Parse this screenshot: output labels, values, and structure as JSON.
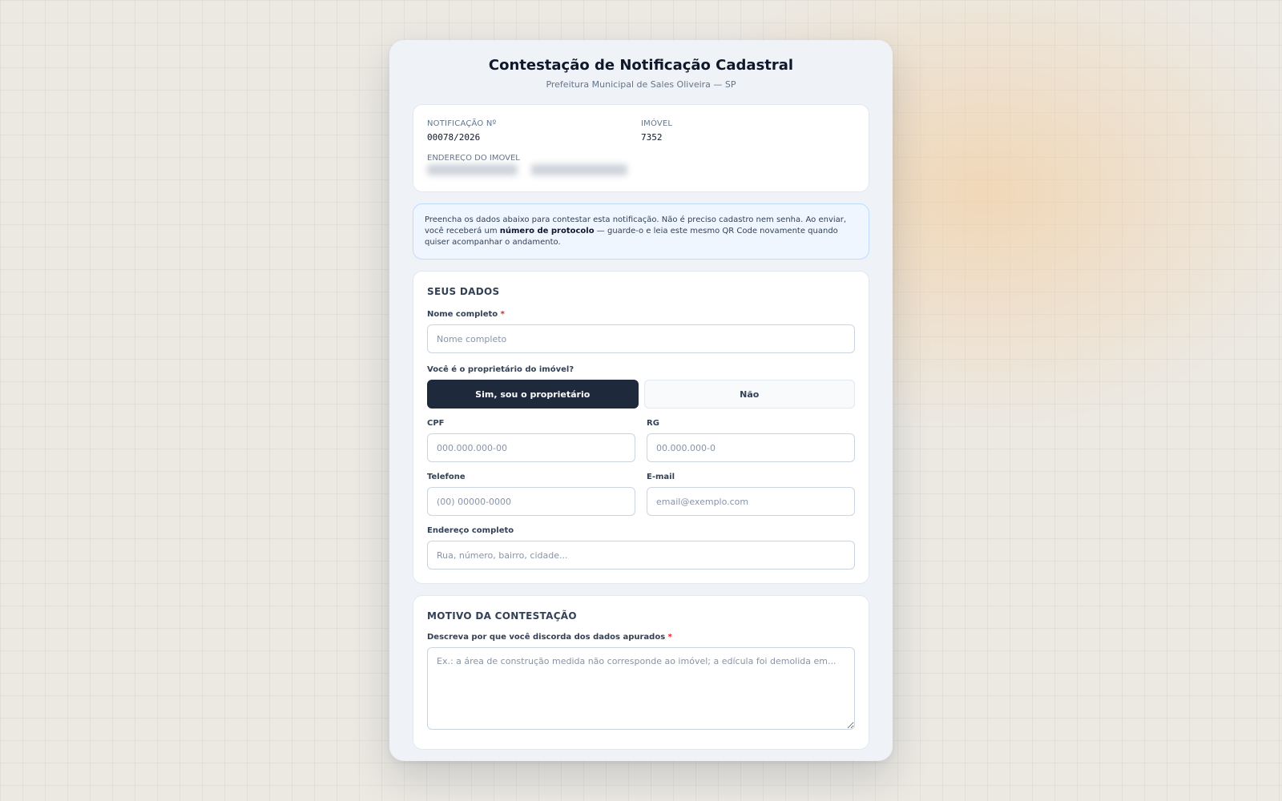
{
  "header": {
    "title": "Contestação de Notificação Cadastral",
    "subtitle": "Prefeitura Municipal de Sales Oliveira — SP"
  },
  "info": {
    "notification_label": "NOTIFICAÇÃO Nº",
    "notification_value": "00078/2026",
    "property_label": "IMÓVEL",
    "property_value": "7352",
    "address_label": "ENDEREÇO DO IMÓVEL"
  },
  "notice": {
    "text_before": "Preencha os dados abaixo para contestar esta notificação. Não é preciso cadastro nem senha. Ao enviar, você receberá um ",
    "text_bold": "número de protocolo",
    "text_after": " — guarde-o e leia este mesmo QR Code novamente quando quiser acompanhar o andamento."
  },
  "personal": {
    "section_title": "SEUS DADOS",
    "name_label": "Nome completo",
    "name_placeholder": "Nome completo",
    "owner_question": "Você é o proprietário do imóvel?",
    "owner_yes": "Sim, sou o proprietário",
    "owner_no": "Não",
    "cpf_label": "CPF",
    "cpf_placeholder": "000.000.000-00",
    "rg_label": "RG",
    "rg_placeholder": "00.000.000-0",
    "phone_label": "Telefone",
    "phone_placeholder": "(00) 00000-0000",
    "email_label": "E-mail",
    "email_placeholder": "email@exemplo.com",
    "address_label": "Endereço completo",
    "address_placeholder": "Rua, número, bairro, cidade..."
  },
  "reason": {
    "section_title": "MOTIVO DA CONTESTAÇÃO",
    "description_label": "Descreva por que você discorda dos dados apurados",
    "description_placeholder": "Ex.: a área de construção medida não corresponde ao imóvel; a edícula foi demolida em..."
  },
  "required_mark": "*"
}
